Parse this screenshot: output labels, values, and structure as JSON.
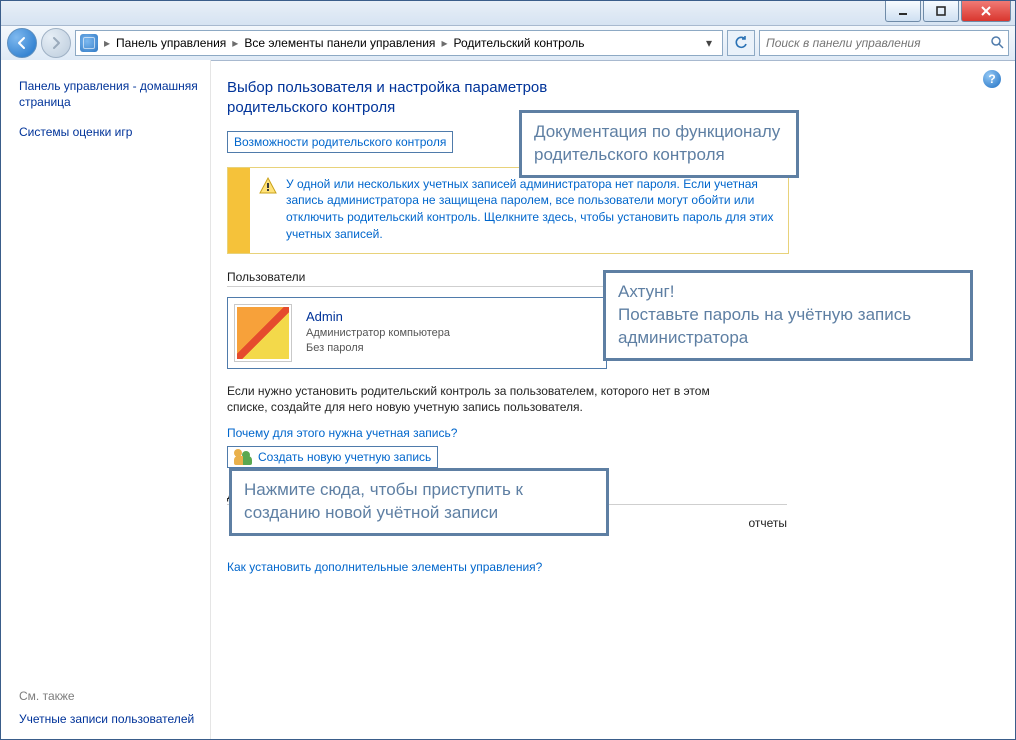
{
  "titlebar": {},
  "nav": {
    "breadcrumb": {
      "seg1": "Панель управления",
      "seg2": "Все элементы панели управления",
      "seg3": "Родительский контроль"
    },
    "search_placeholder": "Поиск в панели управления"
  },
  "sidebar": {
    "home_link": "Панель управления - домашняя страница",
    "games_link": "Системы оценки игр",
    "see_also_label": "См. также",
    "user_accounts_link": "Учетные записи пользователей"
  },
  "main": {
    "title": "Выбор пользователя и настройка параметров родительского контроля",
    "capabilities_link": "Возможности родительского контроля",
    "warning_text": "У одной или нескольких учетных записей администратора нет пароля. Если учетная запись администратора не защищена паролем, все пользователи могут обойти или отключить родительский контроль. Щелкните здесь, чтобы установить пароль для этих учетных записей.",
    "users_label": "Пользователи",
    "user": {
      "name": "Admin",
      "role": "Администратор компьютера",
      "pwd": "Без пароля"
    },
    "extra_para": "Если нужно установить родительский контроль за пользователем, которого нет в этом списке, создайте для него новую учетную запись пользователя.",
    "why_link": "Почему для этого нужна учетная запись?",
    "create_link": "Создать новую учетную запись",
    "addl_label": "Дополнительные элементы управления",
    "addl_desc_tail": "отчеты",
    "install_link": "Как установить дополнительные элементы управления?"
  },
  "annotations": {
    "doc": "Документация по функционалу родительского контроля",
    "achtung": "Ахтунг!\nПоставьте пароль на учётную запись администратора",
    "create": "Нажмите сюда, чтобы приступить к созданию новой учётной записи"
  }
}
